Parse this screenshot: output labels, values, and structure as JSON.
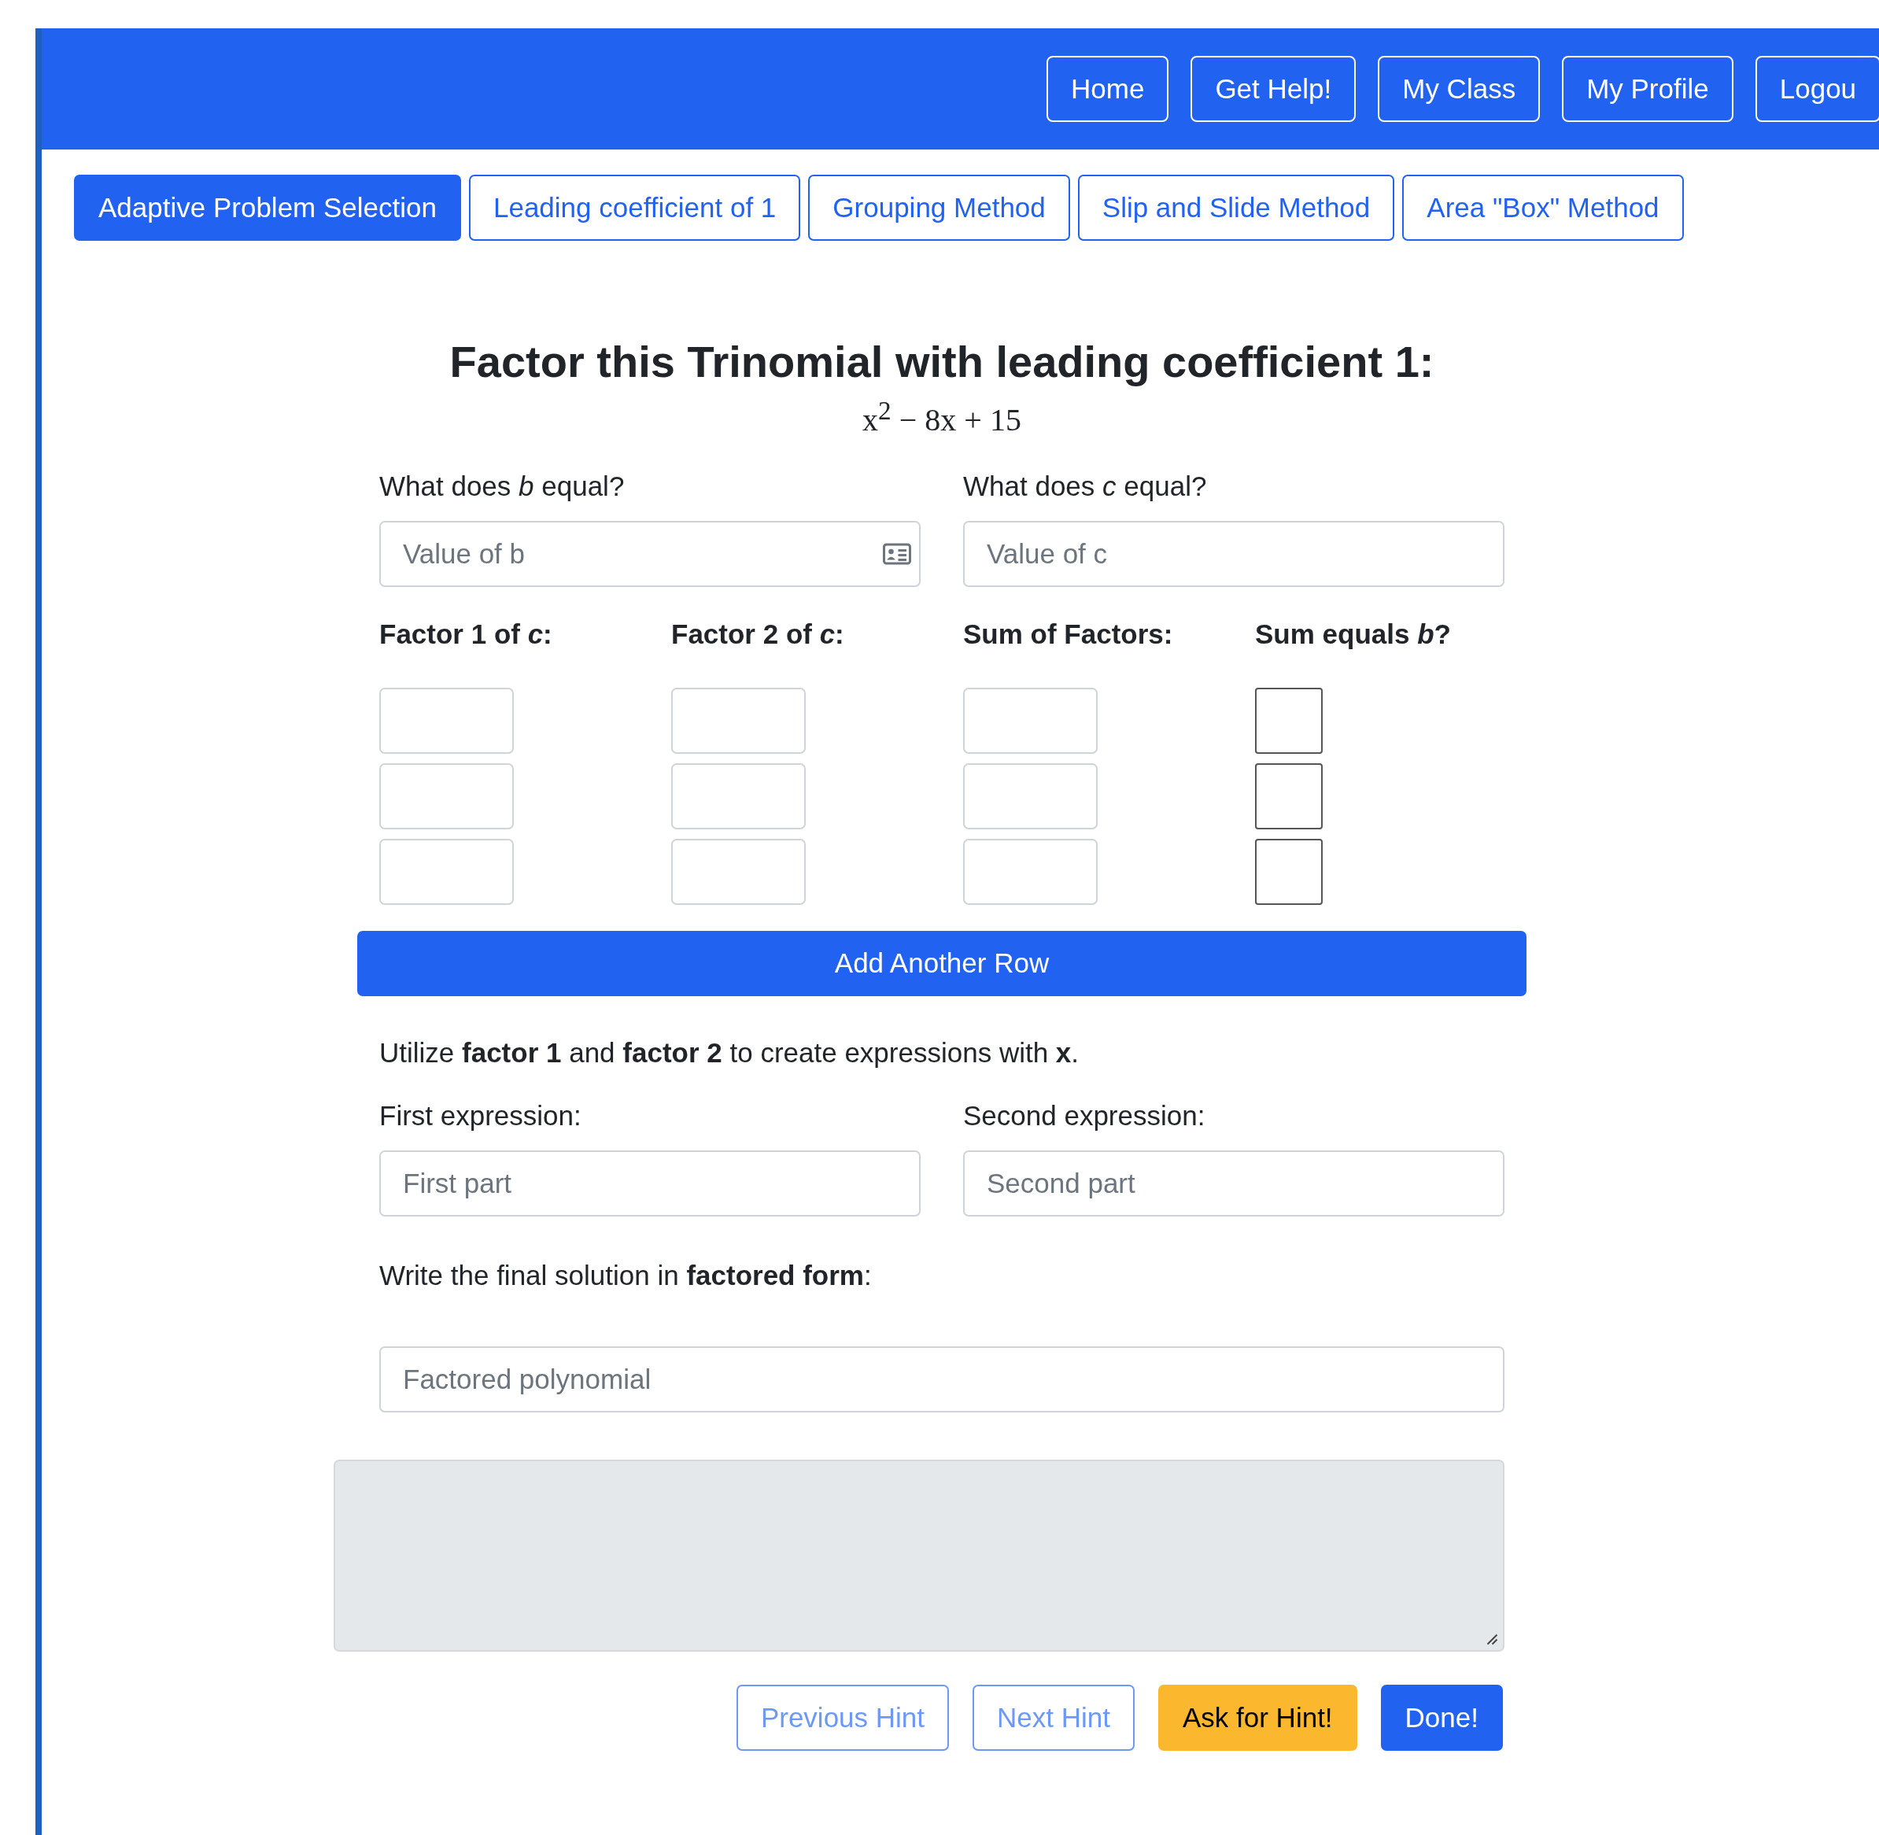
{
  "nav": {
    "buttons": [
      "Home",
      "Get Help!",
      "My Class",
      "My Profile",
      "Logou"
    ]
  },
  "tabs": [
    {
      "label": "Adaptive Problem Selection",
      "selected": true
    },
    {
      "label": "Leading coefficient of 1",
      "selected": false
    },
    {
      "label": "Grouping Method",
      "selected": false
    },
    {
      "label": "Slip and Slide Method",
      "selected": false
    },
    {
      "label": "Area \"Box\" Method",
      "selected": false
    }
  ],
  "problem": {
    "title": "Factor this Trinomial with leading coefficient 1:",
    "expression": "x$^{2}$ − 8x + 15"
  },
  "coefficients": [
    {
      "label": "What does *b* equal?",
      "placeholder": "Value of b",
      "autofill_icon": true
    },
    {
      "label": "What does *c* equal?",
      "placeholder": "Value of c",
      "autofill_icon": false
    }
  ],
  "factor_table": {
    "columns": [
      "Factor 1 of *c*:",
      "Factor 2 of *c*:",
      "Sum of Factors:",
      "Sum equals *b*?"
    ],
    "rows": [
      {
        "checked": false
      },
      {
        "checked": false
      },
      {
        "checked": false
      }
    ]
  },
  "add_row_button": "Add Another Row",
  "instruction": "Utilize **factor 1** and **factor 2** to create expressions with **x**.",
  "expressions": [
    {
      "label": "First expression:",
      "placeholder": "First part"
    },
    {
      "label": "Second expression:",
      "placeholder": "Second part"
    }
  ],
  "final": {
    "label": "Write the final solution in **factored form**:",
    "placeholder": "Factored polynomial"
  },
  "hint_buttons": [
    {
      "label": "Previous Hint",
      "kind": "outline",
      "disabled": true
    },
    {
      "label": "Next Hint",
      "kind": "outline",
      "disabled": true
    },
    {
      "label": "Ask for Hint!",
      "kind": "warning",
      "disabled": false
    },
    {
      "label": "Done!",
      "kind": "primary",
      "disabled": false
    }
  ]
}
